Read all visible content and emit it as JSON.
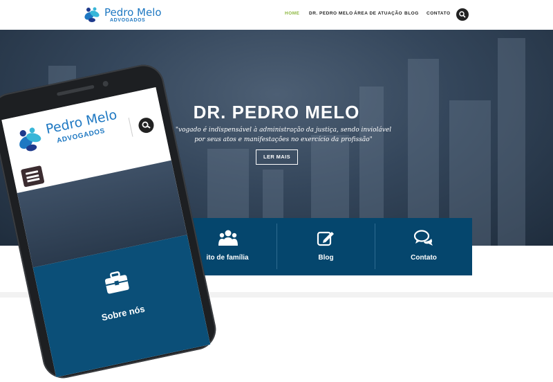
{
  "header": {
    "logo_name": "Pedro Melo",
    "logo_sub": "ADVOGADOS",
    "nav": [
      {
        "label": "HOME",
        "active": true
      },
      {
        "label": "DR. PEDRO MELO",
        "active": false
      },
      {
        "label": "ÁREA DE ATUAÇÃO",
        "active": false
      },
      {
        "label": "BLOG",
        "active": false
      },
      {
        "label": "CONTATO",
        "active": false
      }
    ],
    "search_icon": "search-icon"
  },
  "hero": {
    "title": "DR. PEDRO MELO",
    "quote": "\"vogado é indispensável à administração da justiça, sendo inviolável por seus atos e manifestações no exercício da profissão\"",
    "button_label": "LER MAIS"
  },
  "features": [
    {
      "label": "ito de família",
      "icon": "users-icon"
    },
    {
      "label": "Blog",
      "icon": "edit-icon"
    },
    {
      "label": "Contato",
      "icon": "chat-icon"
    }
  ],
  "phone_screen": {
    "logo_name": "Pedro Melo",
    "logo_sub": "ADVOGADOS",
    "feature_label": "Sobre nós",
    "feature_icon": "briefcase-icon"
  },
  "colors": {
    "brand_blue": "#1e78c2",
    "nav_active": "#8bb63c",
    "strip_bg": "#05466d"
  }
}
